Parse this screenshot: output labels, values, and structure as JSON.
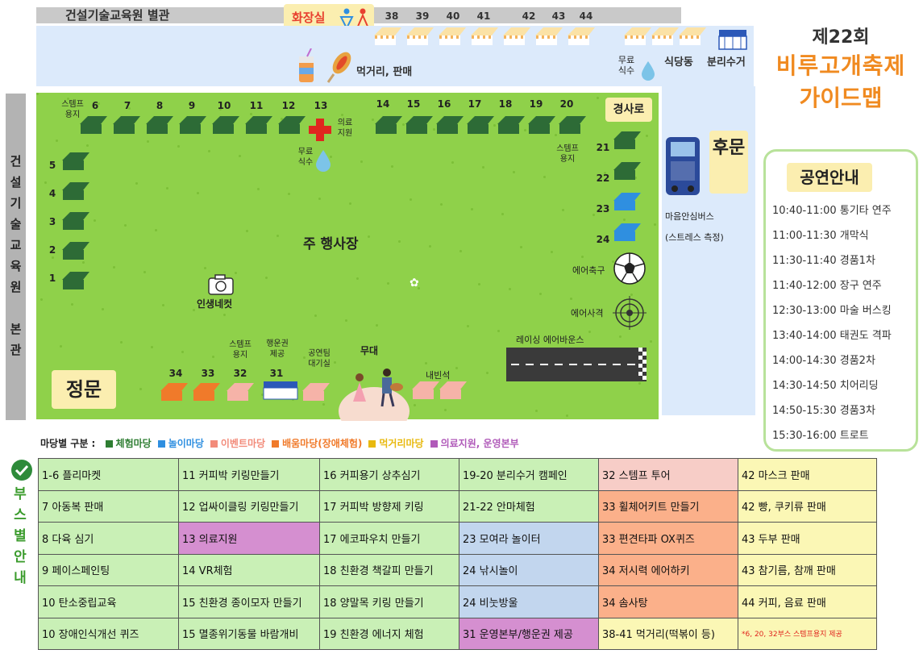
{
  "map": {
    "annex_label": "건설기술교육원 별관",
    "restroom_label": "화장실",
    "food_label": "먹거리, 판매",
    "free_water_label_1": "무료",
    "free_water_label_2": "식수",
    "cafeteria_label": "식당동",
    "recycling_label": "분리수거",
    "top_booth_numbers": [
      "38",
      "39",
      "40",
      "41",
      "42",
      "43",
      "44"
    ],
    "main_building_label": "건설기술교육원 본관",
    "main_building_chars": [
      "건",
      "설",
      "기",
      "술",
      "교",
      "육",
      "원",
      "",
      "본",
      "관"
    ],
    "stamp_label_1": "스템프",
    "stamp_label_2": "용지",
    "row_top_numbers_a": [
      "6",
      "7",
      "8",
      "9",
      "10",
      "11",
      "12",
      "13"
    ],
    "row_top_numbers_b": [
      "14",
      "15",
      "16",
      "17",
      "18",
      "19",
      "20"
    ],
    "left_column_numbers": [
      "5",
      "4",
      "3",
      "2",
      "1"
    ],
    "right_column_numbers": [
      "21",
      "22",
      "23",
      "24"
    ],
    "medical_label_1": "의료",
    "medical_label_2": "지원",
    "slope_road": "경사로",
    "back_gate": "후문",
    "bus_label_1": "마음안심버스",
    "bus_label_2": "(스트레스 측정)",
    "main_venue": "주 행사장",
    "photo_spot": "인생네컷",
    "air_soccer": "에어축구",
    "air_shooting": "에어사격",
    "racing_bounce": "레이싱 에어바운스",
    "main_gate": "정문",
    "stage": "무대",
    "guest_seats": "내빈석",
    "bottom_numbers": [
      "34",
      "33",
      "32",
      "31"
    ],
    "ticket_label_1": "행운권",
    "ticket_label_2": "제공",
    "performer_label_1": "공연팀",
    "performer_label_2": "대기실"
  },
  "festival": {
    "title_line1": "제22회",
    "title_line2": "비루고개축제",
    "title_line3": "가이드맵"
  },
  "performance": {
    "title": "공연안내",
    "items": [
      "10:40-11:00 통기타 연주",
      "11:00-11:30 개막식",
      "11:30-11:40 경품1차",
      "11:40-12:00 장구 연주",
      "12:30-13:00 마술 버스킹",
      "13:40-14:00 태권도 격파",
      "14:00-14:30 경품2차",
      "14:30-14:50 치어리딩",
      "14:50-15:30 경품3차",
      "15:30-16:00 트로트"
    ]
  },
  "legend": {
    "prefix": "마당별 구분 :",
    "items": [
      {
        "label": "체험마당",
        "color": "#2e7d32"
      },
      {
        "label": "놀이마당",
        "color": "#2f8fe0"
      },
      {
        "label": "이벤트마당",
        "color": "#f28b7a"
      },
      {
        "label": "배움마당(장애체험)",
        "color": "#f07a2a"
      },
      {
        "label": "먹거리마당",
        "color": "#e8b90f"
      },
      {
        "label": "의료지원, 운영본부",
        "color": "#b05ab9"
      }
    ]
  },
  "booth_guide": {
    "side_label": [
      "부",
      "스",
      "별",
      "안",
      "내"
    ],
    "columns": [
      {
        "bg": "#c9f0b6",
        "cells": [
          "1-6 플리마켓",
          "7 아동복 판매",
          "8 다육 심기",
          "9 페이스페인팅",
          "10 탄소중립교육",
          "10 장애인식개선 퀴즈"
        ]
      },
      {
        "bg": "#c9f0b6",
        "cells": [
          "11 커피박 키링만들기",
          "12 업싸이클링 키링만들기",
          "13 의료지원",
          "14 VR체험",
          "15 친환경 종이모자 만들기",
          "15 멸종위기동물 바람개비"
        ]
      },
      {
        "bg": "#c9f0b6",
        "cells": [
          "16 커피용기 상추심기",
          "17 커피박 방향제 키링",
          "17 에코파우치 만들기",
          "18 친환경 책갈피 만들기",
          "18 양말목 키링 만들기",
          "19 친환경 에너지 체험"
        ]
      },
      {
        "bg": "#c9f0b6",
        "cells": [
          "19-20 분리수거 캠페인",
          "21-22 안마체험",
          "23 모여라 놀이터",
          "24 낚시놀이",
          "24 비눗방울",
          "31 운영본부/행운권 제공"
        ]
      },
      {
        "bg": "#f7c8bc",
        "cells": [
          "32 스템프 투어",
          "33 휠체어키트 만들기",
          "33 편견타파 OX퀴즈",
          "34 저시력 에어하키",
          "34 솜사탕",
          "38-41 먹거리(떡볶이 등)"
        ]
      },
      {
        "bg": "#fbf7b5",
        "cells": [
          "42 마스크 판매",
          "42 빵, 쿠키류 판매",
          "43 두부 판매",
          "43 참기름, 참깨 판매",
          "44 커피, 음료 판매",
          "*6, 20, 32부스 스템프용지 제공"
        ]
      }
    ],
    "special_colors": {
      "medical": "#d58fd0",
      "play": "#c2d6ee",
      "learning": "#fbb08a",
      "event": "#f7cdc7",
      "food": "#fbf7b5"
    }
  }
}
